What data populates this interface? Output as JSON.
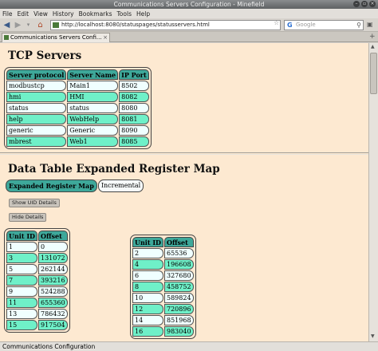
{
  "window": {
    "title": "Communications Servers Configuration - Minefield"
  },
  "menu": [
    "File",
    "Edit",
    "View",
    "History",
    "Bookmarks",
    "Tools",
    "Help"
  ],
  "navigation": {
    "url": "http://localhost:8080/statuspages/statusservers.html",
    "search_placeholder": "Google"
  },
  "tab": {
    "label": "Communications Servers Confi..."
  },
  "tcp_servers": {
    "heading": "TCP Servers",
    "columns": [
      "Server protocol",
      "Server Name",
      "IP Port"
    ],
    "rows": [
      [
        "modbustcp",
        "Main1",
        "8502"
      ],
      [
        "hmi",
        "HMI",
        "8082"
      ],
      [
        "status",
        "status",
        "8080"
      ],
      [
        "help",
        "WebHelp",
        "8081"
      ],
      [
        "generic",
        "Generic",
        "8090"
      ],
      [
        "mbrest",
        "Web1",
        "8085"
      ]
    ]
  },
  "register_map": {
    "heading": "Data Table Expanded Register Map",
    "view_tabs": [
      "Expanded Register Map",
      "Incremental"
    ],
    "active_tab": "Expanded Register Map",
    "show_button": "Show UID Details",
    "hide_button": "Hide Details",
    "columns": [
      "Unit ID",
      "Offset"
    ],
    "left_rows": [
      [
        "1",
        "0"
      ],
      [
        "3",
        "131072"
      ],
      [
        "5",
        "262144"
      ],
      [
        "7",
        "393216"
      ],
      [
        "9",
        "524288"
      ],
      [
        "11",
        "655360"
      ],
      [
        "13",
        "786432"
      ],
      [
        "15",
        "917504"
      ]
    ],
    "right_rows": [
      [
        "2",
        "65536"
      ],
      [
        "4",
        "196608"
      ],
      [
        "6",
        "327680"
      ],
      [
        "8",
        "458752"
      ],
      [
        "10",
        "589824"
      ],
      [
        "12",
        "720896"
      ],
      [
        "14",
        "851968"
      ],
      [
        "16",
        "983040"
      ]
    ]
  },
  "status": {
    "text": "Communications Configuration"
  }
}
